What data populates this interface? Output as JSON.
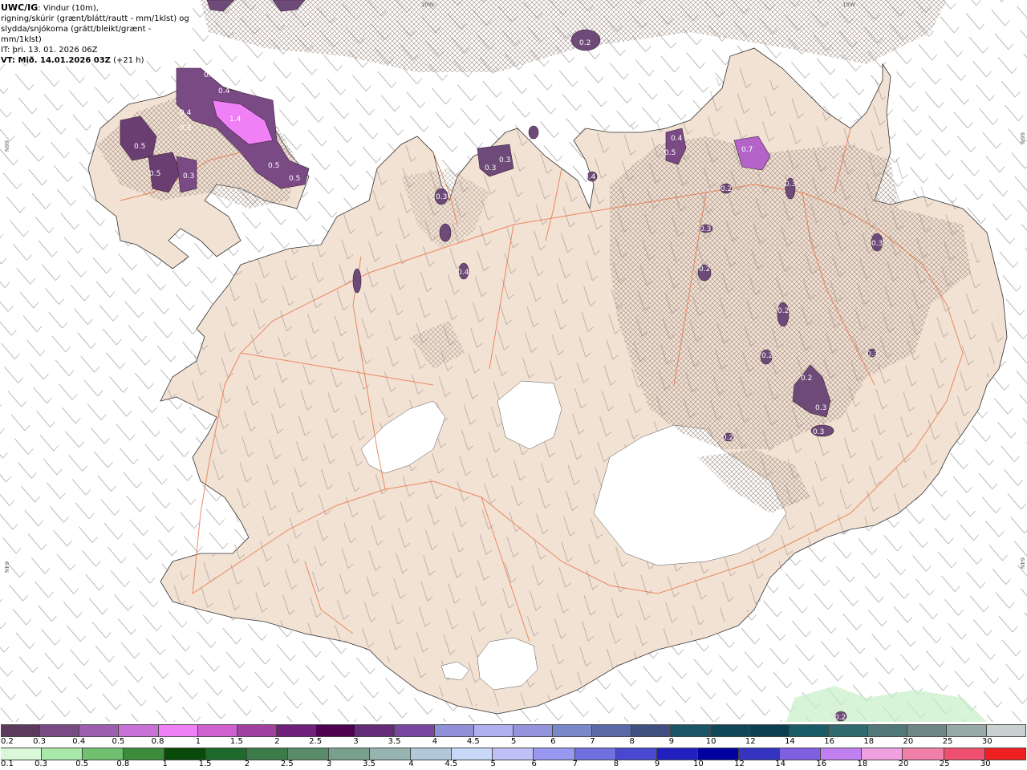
{
  "header": {
    "model": "UWC/IG",
    "line1": ": Vindur (10m),",
    "line2": "rigning/skúrir (grænt/blátt/rautt - mm/1klst) og",
    "line3": "slydda/snjókoma (grátt/bleikt/grænt - mm/1klst)",
    "issued": "IT: þri. 13. 01. 2026 06Z",
    "valid": "VT: Mið. 14.01.2026 03Z",
    "lead": "(+21 h)"
  },
  "coords": {
    "top1": "20W",
    "top2": "15W",
    "left1": "66N",
    "left2": "64N",
    "right1": "66N",
    "right2": "64N"
  },
  "map_labels": [
    "0.2",
    "0.3",
    "0.4",
    "0.4",
    "0.3",
    "0.5",
    "0.5",
    "0.3",
    "1.4",
    "0.5",
    "0.5",
    "0.3",
    "0.3",
    "0.3",
    "0.4",
    "0.5",
    "0.7",
    "0.2",
    "0.3",
    "0.3",
    "0.4",
    "0.2",
    "0.3",
    "0.2",
    "0.2",
    "0.3",
    "0.3",
    "0.2",
    "0.3",
    "0.2",
    "0.4",
    "0.2"
  ],
  "legend": {
    "snow": {
      "labels": [
        "0.2",
        "0.3",
        "0.4",
        "0.5",
        "0.8",
        "1",
        "1.5",
        "2",
        "2.5",
        "3",
        "3.5",
        "4",
        "4.5",
        "5",
        "6",
        "7",
        "8",
        "9",
        "10",
        "12",
        "14",
        "16",
        "18",
        "20",
        "25",
        "30"
      ],
      "colors": [
        "#5b3a5e",
        "#7a4a85",
        "#9e5eb0",
        "#c872d8",
        "#f080f6",
        "#d060d0",
        "#a040a0",
        "#70207a",
        "#500050",
        "#642c78",
        "#7848a0",
        "#9090d8",
        "#b0b0f0",
        "#9494dc",
        "#7888c8",
        "#5a6aa8",
        "#405080",
        "#1c5468",
        "#104858",
        "#0a4050",
        "#185c68",
        "#306a70",
        "#507878",
        "#6e8888",
        "#98aaa8",
        "#c8d0d0"
      ]
    },
    "rain": {
      "labels": [
        "0.1",
        "0.3",
        "0.5",
        "0.8",
        "1",
        "1.5",
        "2",
        "2.5",
        "3",
        "3.5",
        "4",
        "4.5",
        "5",
        "6",
        "7",
        "8",
        "9",
        "10",
        "12",
        "14",
        "16",
        "18",
        "20",
        "25",
        "30"
      ],
      "colors": [
        "#d8f8d8",
        "#a8e8a8",
        "#70c070",
        "#3c8c3c",
        "#0a4a0a",
        "#1e6a2a",
        "#3c7c4a",
        "#5a8c6a",
        "#78a08c",
        "#98b4b0",
        "#b0c8d8",
        "#c8d8f8",
        "#c0c0f8",
        "#9898f0",
        "#7070e0",
        "#4848d0",
        "#2020c0",
        "#0000a0",
        "#3434c0",
        "#8060e0",
        "#c080f0",
        "#f0a0e0",
        "#f080a8",
        "#f05070",
        "#f02020"
      ]
    }
  }
}
